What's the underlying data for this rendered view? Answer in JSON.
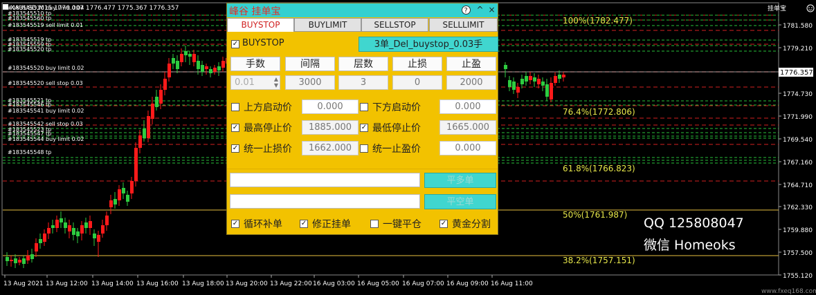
{
  "chart": {
    "symbol_info": "XAUUSD,M15  1776.007 1776.477 1775.367 1776.357",
    "indicator_label": "挂单宝",
    "watermark": "www.fxeq168.com",
    "current_price": "1776.357",
    "price_axis": [
      "1781.580",
      "1779.210",
      "1776.840",
      "1774.730",
      "1771.990",
      "1769.540",
      "1767.160",
      "1764.710",
      "1762.330",
      "1759.880",
      "1757.500",
      "1755.120"
    ],
    "time_axis": [
      "13 Aug 2021",
      "13 Aug 12:00",
      "13 Aug 14:00",
      "13 Aug 16:00",
      "13 Aug 18:00",
      "13 Aug 20:00",
      "13 Aug 22:00",
      "16 Aug 03:00",
      "16 Aug 05:00",
      "16 Aug 07:00",
      "16 Aug 09:00",
      "16 Aug 11:00"
    ],
    "fib_levels": [
      "100%(1782.477)",
      "76.4%(1772.806)",
      "61.8%(1766.823)",
      "50%(1761.987)",
      "38.2%(1757.151)"
    ],
    "order_labels": [
      "#183545510 buy limit 0.04",
      "#183545510 tp",
      "#183545560 tp",
      "#183545519 sell limit 0.01",
      "#183545519 tp",
      "#183545559 tp",
      "#183545520 tp",
      "#183545520 buy limit 0.02",
      "#183545520 sell stop 0.03",
      "#183545521 tp",
      "#183545546 tp",
      "#183545541 buy limit 0.02",
      "#183545542 sell stop 0.03",
      "#183545523 tp",
      "#183545547 tp",
      "#183545544 buy limit 0.02",
      "#183545548 tp"
    ],
    "contact": {
      "qq": "QQ 125808047",
      "wechat": "微信 Homeoks"
    }
  },
  "panel": {
    "title": "峰谷 挂单宝",
    "window_buttons": [
      "?",
      "^",
      "×"
    ],
    "tabs": [
      "BUYSTOP",
      "BUYLIMIT",
      "SELLSTOP",
      "SELLLIMIT"
    ],
    "active_tab": "BUYSTOP",
    "enable_label": "BUYSTOP",
    "enable_checked": true,
    "action_button": "3单_Del_buystop_0.03手",
    "headers": [
      "手数",
      "间隔",
      "层数",
      "止损",
      "止盈"
    ],
    "values": {
      "lots": "0.01",
      "interval": "3000",
      "layers": "3",
      "sl": "0",
      "tp": "2000"
    },
    "rows": [
      {
        "left_label": "上方启动价",
        "left_checked": false,
        "left_value": "0.000",
        "right_label": "下方启动价",
        "right_checked": false,
        "right_value": "0.000"
      },
      {
        "left_label": "最高停止价",
        "left_checked": true,
        "left_value": "1885.000",
        "right_label": "最低停止价",
        "right_checked": true,
        "right_value": "1665.000"
      },
      {
        "left_label": "统一止损价",
        "left_checked": true,
        "left_value": "1662.000",
        "right_label": "统一止盈价",
        "right_checked": false,
        "right_value": "0.000"
      }
    ],
    "close_buttons": [
      "平多单",
      "平空单"
    ],
    "bottom_checks": [
      {
        "label": "循环补单",
        "checked": true
      },
      {
        "label": "修正挂单",
        "checked": true
      },
      {
        "label": "一键平仓",
        "checked": false
      },
      {
        "label": "黄金分割",
        "checked": true
      }
    ]
  },
  "colors": {
    "panel_bg": "#f2c200",
    "cyan": "#40d6cf",
    "bull": "#2ecc40",
    "bear": "#ff1a1a",
    "fib": "#e8e84a"
  }
}
